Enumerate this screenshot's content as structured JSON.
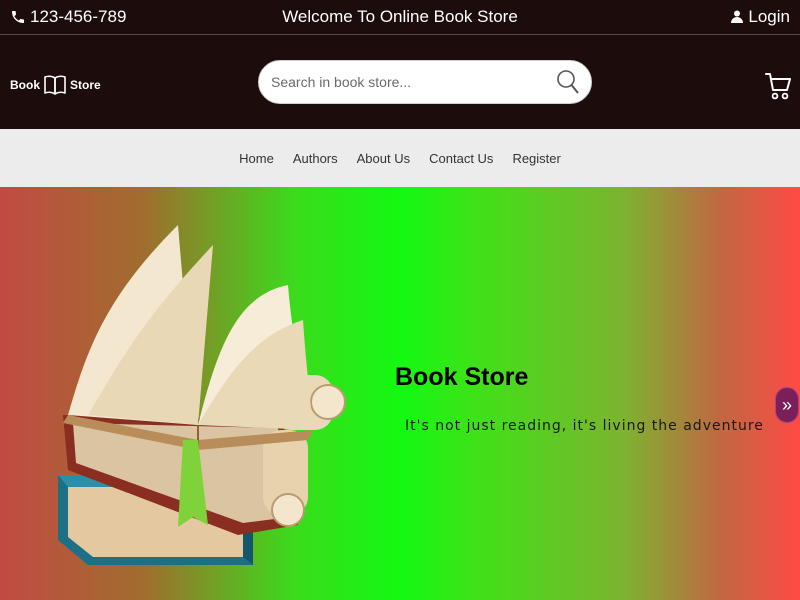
{
  "topbar": {
    "phone": "123-456-789",
    "welcome": "Welcome To Online Book Store",
    "login": "Login"
  },
  "logo": {
    "left_text": "Book",
    "right_text": "Store"
  },
  "search": {
    "placeholder": "Search in book store..."
  },
  "nav": {
    "items": [
      "Home",
      "Authors",
      "About Us",
      "Contact Us",
      "Register"
    ]
  },
  "hero": {
    "title": "Book Store",
    "subtitle": "It's not just reading, it's living the adventure",
    "next_label": "»"
  },
  "icons": {
    "phone": "phone-icon",
    "user": "user-icon",
    "logo": "open-book-icon",
    "search": "search-icon",
    "cart": "cart-icon",
    "next": "chevron-right-icon"
  },
  "colors": {
    "header_bg": "#1d0c0c",
    "nav_bg": "#ececec",
    "next_button": "#7a1f5a"
  }
}
